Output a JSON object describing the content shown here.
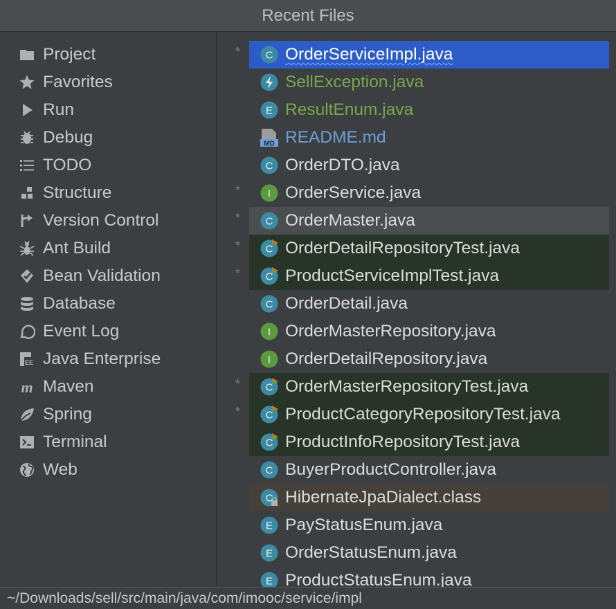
{
  "window": {
    "title": "Recent Files"
  },
  "tool_windows": [
    {
      "label": "Project",
      "icon": "folder-icon"
    },
    {
      "label": "Favorites",
      "icon": "star-icon"
    },
    {
      "label": "Run",
      "icon": "run-icon"
    },
    {
      "label": "Debug",
      "icon": "bug-icon"
    },
    {
      "label": "TODO",
      "icon": "list-icon"
    },
    {
      "label": "Structure",
      "icon": "structure-icon"
    },
    {
      "label": "Version Control",
      "icon": "vcs-icon"
    },
    {
      "label": "Ant Build",
      "icon": "ant-icon"
    },
    {
      "label": "Bean Validation",
      "icon": "bean-icon"
    },
    {
      "label": "Database",
      "icon": "database-icon"
    },
    {
      "label": "Event Log",
      "icon": "event-log-icon"
    },
    {
      "label": "Java Enterprise",
      "icon": "java-enterprise-icon"
    },
    {
      "label": "Maven",
      "icon": "maven-icon"
    },
    {
      "label": "Spring",
      "icon": "spring-icon"
    },
    {
      "label": "Terminal",
      "icon": "terminal-icon"
    },
    {
      "label": "Web",
      "icon": "globe-icon"
    }
  ],
  "files": [
    {
      "name": "OrderServiceImpl.java",
      "type": "class",
      "modified": "*",
      "state": "selected",
      "color": "sel"
    },
    {
      "name": "SellException.java",
      "type": "exception",
      "modified": "",
      "state": "",
      "color": "green"
    },
    {
      "name": "ResultEnum.java",
      "type": "enum",
      "modified": "",
      "state": "",
      "color": "green"
    },
    {
      "name": "README.md",
      "type": "markdown",
      "modified": "",
      "state": "",
      "color": "blue"
    },
    {
      "name": "OrderDTO.java",
      "type": "class",
      "modified": "",
      "state": "",
      "color": "white"
    },
    {
      "name": "OrderService.java",
      "type": "interface",
      "modified": "*",
      "state": "",
      "color": "white"
    },
    {
      "name": "OrderMaster.java",
      "type": "class",
      "modified": "*",
      "state": "hover",
      "color": "white"
    },
    {
      "name": "OrderDetailRepositoryTest.java",
      "type": "test",
      "modified": "*",
      "state": "test",
      "color": "white"
    },
    {
      "name": "ProductServiceImplTest.java",
      "type": "test",
      "modified": "*",
      "state": "test",
      "color": "white"
    },
    {
      "name": "OrderDetail.java",
      "type": "class",
      "modified": "",
      "state": "",
      "color": "white"
    },
    {
      "name": "OrderMasterRepository.java",
      "type": "interface",
      "modified": "",
      "state": "",
      "color": "white"
    },
    {
      "name": "OrderDetailRepository.java",
      "type": "interface",
      "modified": "",
      "state": "",
      "color": "white"
    },
    {
      "name": "OrderMasterRepositoryTest.java",
      "type": "test",
      "modified": "*",
      "state": "test",
      "color": "white"
    },
    {
      "name": "ProductCategoryRepositoryTest.java",
      "type": "test",
      "modified": "*",
      "state": "test",
      "color": "white"
    },
    {
      "name": "ProductInfoRepositoryTest.java",
      "type": "test",
      "modified": "",
      "state": "test",
      "color": "white"
    },
    {
      "name": "BuyerProductController.java",
      "type": "class",
      "modified": "",
      "state": "",
      "color": "white"
    },
    {
      "name": "HibernateJpaDialect.class",
      "type": "compiled-class",
      "modified": "",
      "state": "cls",
      "color": "white"
    },
    {
      "name": "PayStatusEnum.java",
      "type": "enum",
      "modified": "",
      "state": "",
      "color": "white"
    },
    {
      "name": "OrderStatusEnum.java",
      "type": "enum",
      "modified": "",
      "state": "",
      "color": "white"
    },
    {
      "name": "ProductStatusEnum.java",
      "type": "enum",
      "modified": "",
      "state": "",
      "color": "white"
    }
  ],
  "status": {
    "path": "~/Downloads/sell/src/main/java/com/imooc/service/impl"
  },
  "colors": {
    "background": "#3c3f41",
    "selection": "#2d5cc9",
    "test_bg": "#283428",
    "class_bg": "#45403a",
    "green_text": "#79a64e",
    "blue_text": "#6d9fd6"
  }
}
